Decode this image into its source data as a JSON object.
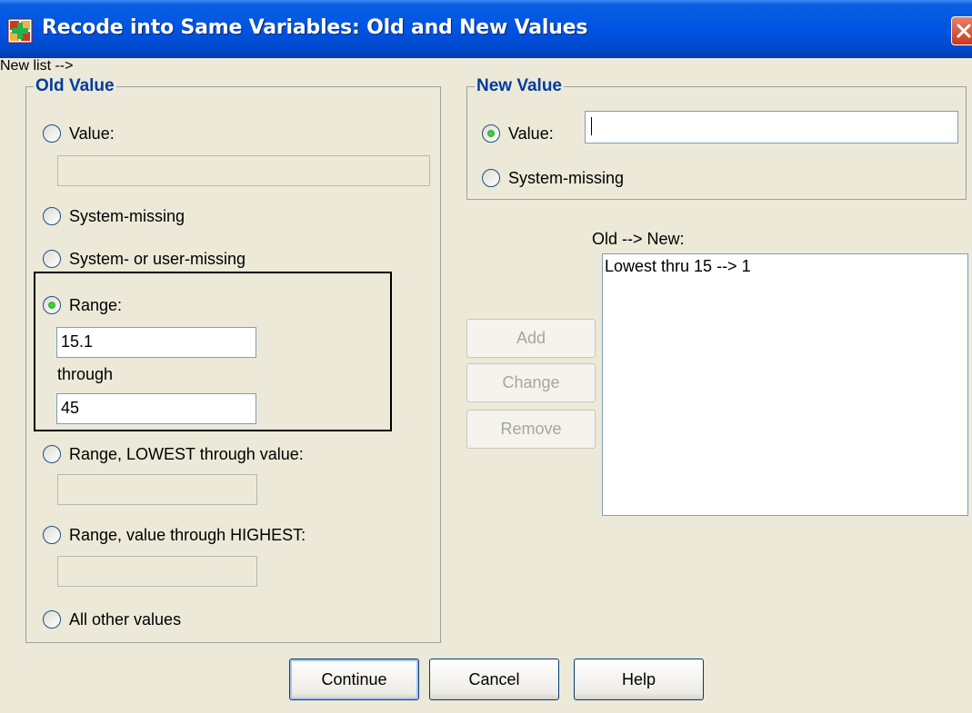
{
  "window": {
    "title": "Recode into Same Variables: Old and New Values"
  },
  "old_value": {
    "legend": "Old Value",
    "value_label": "Value:",
    "value_field": "",
    "system_missing_label": "System-missing",
    "sys_or_user_missing_label": "System- or user-missing",
    "range_label": "Range:",
    "range_from": "15.1",
    "through_label": "through",
    "range_to": "45",
    "range_lowest_label": "Range, LOWEST through value:",
    "range_lowest_field": "",
    "range_highest_label": "Range, value through HIGHEST:",
    "range_highest_field": "",
    "all_other_label": "All other values",
    "selected": "Range:"
  },
  "new_value": {
    "legend": "New Value",
    "value_label": "Value:",
    "value_field": "",
    "system_missing_label": "System-missing",
    "selected": "Value:"
  },
  "mapping": {
    "label": "Old --> New:",
    "items": [
      "Lowest thru 15 --> 1"
    ]
  },
  "side_buttons": {
    "add": "Add",
    "change": "Change",
    "remove": "Remove"
  },
  "footer": {
    "continue": "Continue",
    "cancel": "Cancel",
    "help": "Help"
  },
  "icons": {
    "app": "spss-recode-icon",
    "close": "close-icon"
  },
  "colors": {
    "title_bar": "#0054e3",
    "legend_text": "#003c9e",
    "dialog_bg": "#ece9d8",
    "close_button": "#c83a1e"
  }
}
